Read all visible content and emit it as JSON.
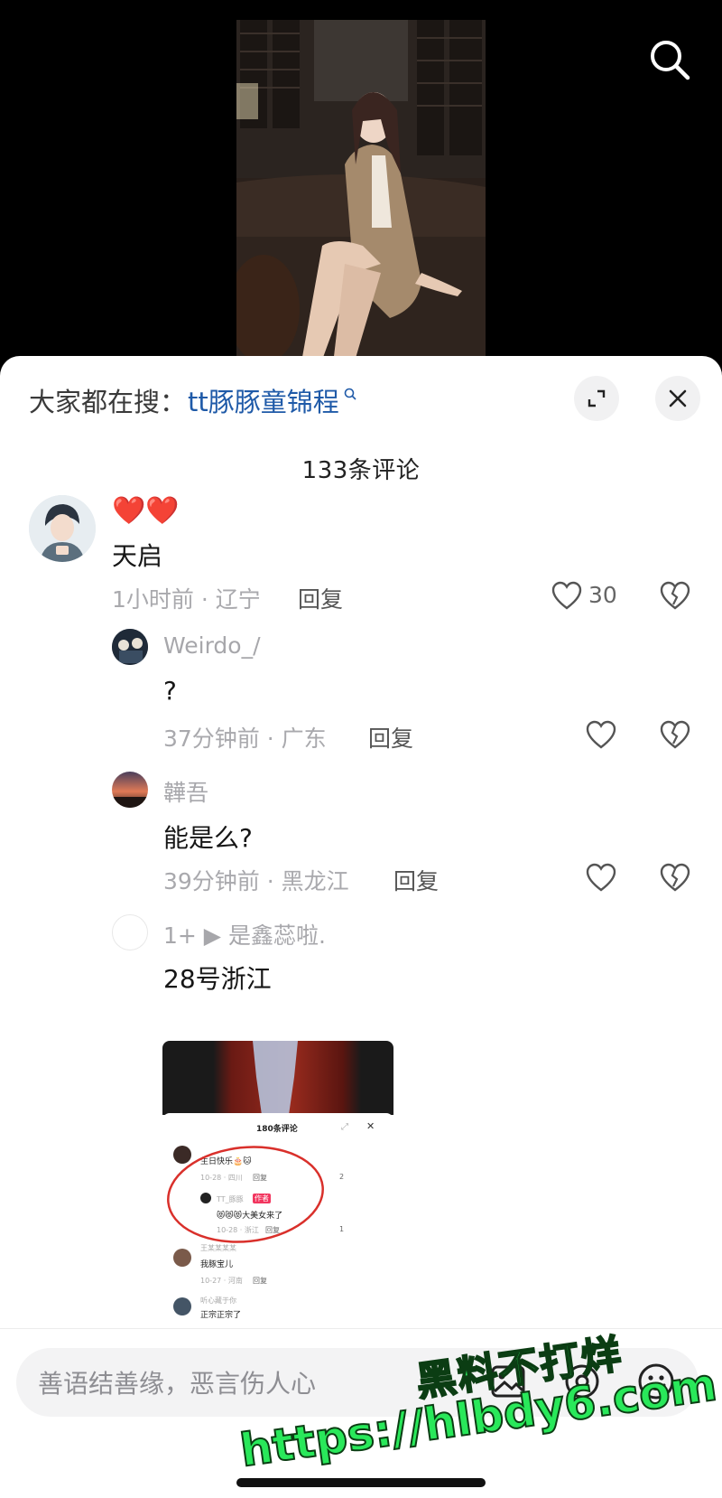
{
  "top_bar": {
    "search_icon": "search-icon"
  },
  "sheet": {
    "search_hint_label": "大家都在搜：",
    "search_hint_term": "tt豚豚童锦程",
    "expand_icon": "expand-icon",
    "close_icon": "close-icon",
    "comment_count": "133条评论"
  },
  "comments": [
    {
      "emoji": "❤️❤️",
      "text": "天启",
      "meta": "1小时前 · 辽宁",
      "reply": "回复",
      "likes": "30"
    },
    {
      "name": "Weirdo_/",
      "text": "?",
      "meta": "37分钟前 · 广东",
      "reply": "回复"
    },
    {
      "name": "韡吾",
      "text": "能是么?",
      "meta": "39分钟前 · 黑龙江",
      "reply": "回复"
    },
    {
      "name": "1+ ▶ 是鑫蕊啦.",
      "text": "28号浙江"
    }
  ],
  "thumbnail": {
    "count": "180条评论",
    "c1_text": "生日快乐🎂🐱",
    "c1_meta": "10-28 · 四川",
    "c1_reply": "回复",
    "c1_likes": "2",
    "c2_name": "TT_豚豚",
    "c2_badge": "作者",
    "c2_text": "😻😻😻大美女来了",
    "c2_meta": "10-28 · 浙江",
    "c2_reply": "回复",
    "c2_likes": "1",
    "c3_name": "王某某某某",
    "c3_text": "我豚宝儿",
    "c3_meta": "10-27 · 河南",
    "c3_reply": "回复",
    "c4_name": "听心藏于你",
    "c4_text": "正宗正宗了"
  },
  "input": {
    "placeholder": "善语结善缘，恶言伤人心",
    "image_icon": "image-icon",
    "mention_icon": "at-mention-icon",
    "emoji_icon": "emoji-icon"
  },
  "watermark": {
    "line1": "黑料不打烊",
    "line2": "https://hlbdy6.com"
  },
  "colors": {
    "link_blue": "#1f5aa8",
    "grey_meta": "#a9a9ad",
    "watermark_green": "#29e85a"
  }
}
